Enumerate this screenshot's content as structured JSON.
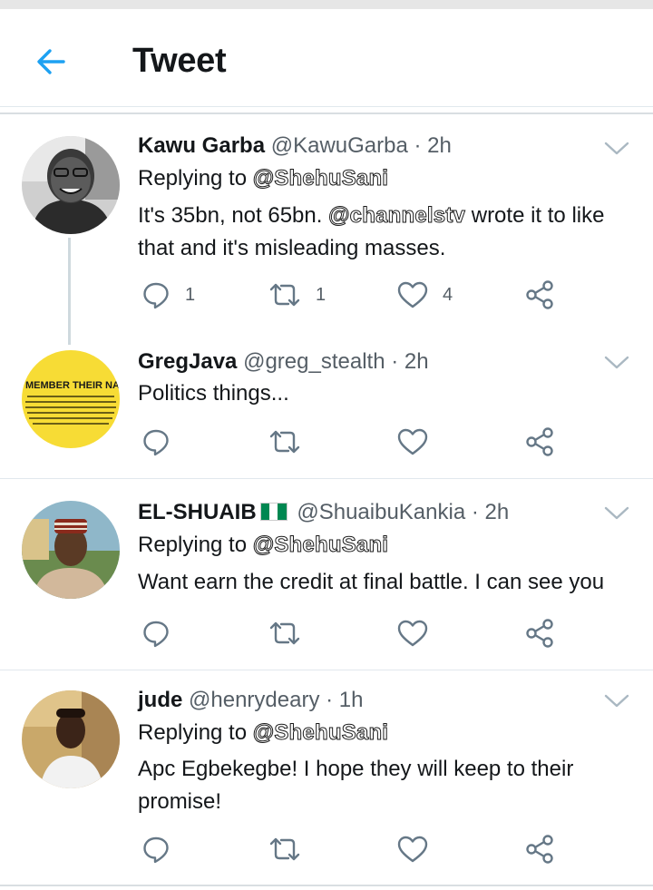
{
  "header": {
    "title": "Tweet",
    "back_icon": "arrow-left-icon",
    "accent": "#1da1f2"
  },
  "tweets": [
    {
      "name": "Kawu Garba",
      "handle": "@KawuGarba",
      "dot": "·",
      "time": "2h",
      "replying_prefix": "Replying to",
      "replying_to": "@ShehuSani",
      "text_before": "It's 35bn, not 65bn. ",
      "text_mention": "@channelstv",
      "text_after": " wrote it to like that and it's misleading masses.",
      "reply_count": "1",
      "retweet_count": "1",
      "like_count": "4"
    },
    {
      "name": "GregJava",
      "handle": "@greg_stealth",
      "dot": "·",
      "time": "2h",
      "text": "Politics things...",
      "avatar_text": "MEMBER THEIR NA"
    },
    {
      "name": "EL-SHUAIB",
      "handle": "@ShuaibuKankia",
      "dot": "·",
      "time": "2h",
      "flag_colors": [
        "#008751",
        "#ffffff",
        "#008751"
      ],
      "replying_prefix": "Replying to",
      "replying_to": "@ShehuSani",
      "text": "Want earn the credit at final battle. I can see you"
    },
    {
      "name": "jude",
      "handle": "@henrydeary",
      "dot": "·",
      "time": "1h",
      "replying_prefix": "Replying to",
      "replying_to": "@ShehuSani",
      "text": "Apc Egbekegbe! I hope they will keep to their promise!"
    }
  ],
  "icons": {
    "reply": "reply-icon",
    "retweet": "retweet-icon",
    "like": "heart-icon",
    "share": "share-icon",
    "menu": "chevron-down-icon"
  },
  "colors": {
    "icon": "#657786",
    "text": "#14171a",
    "muted": "#555e66",
    "divider": "#e1e8ed"
  }
}
